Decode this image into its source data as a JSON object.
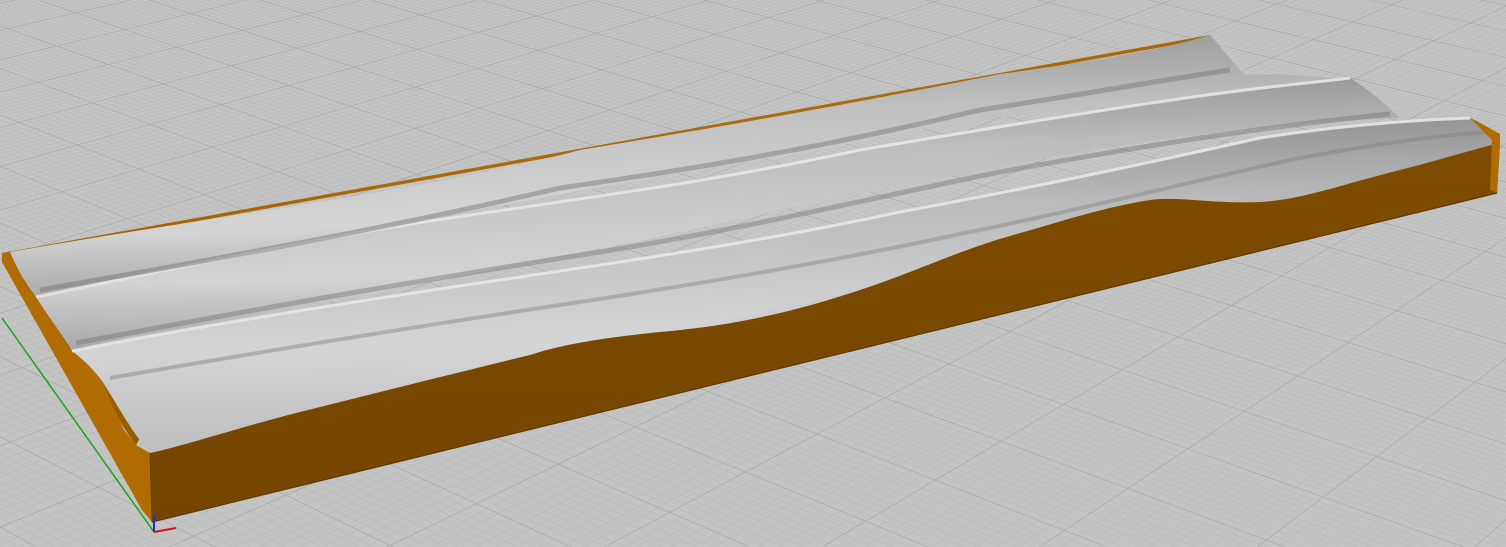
{
  "viewport": {
    "view": "perspective",
    "background_color": "#c4c4c4",
    "grid": {
      "visible": true,
      "minor_line_color": "#b6b6b6",
      "major_line_color": "#a9a9a9"
    }
  },
  "model": {
    "kind": "wavy-grooved-board",
    "groove_count": 3,
    "wood_top_color": "#b06c00",
    "wood_side_color": "#7a4800",
    "surface_light_color": "#d8d8d8",
    "surface_shadow_color": "#8a8a8a"
  },
  "axis_gizmo": {
    "x_color": "#d21414",
    "y_color": "#1aa31a",
    "z_color": "#2030d0"
  }
}
